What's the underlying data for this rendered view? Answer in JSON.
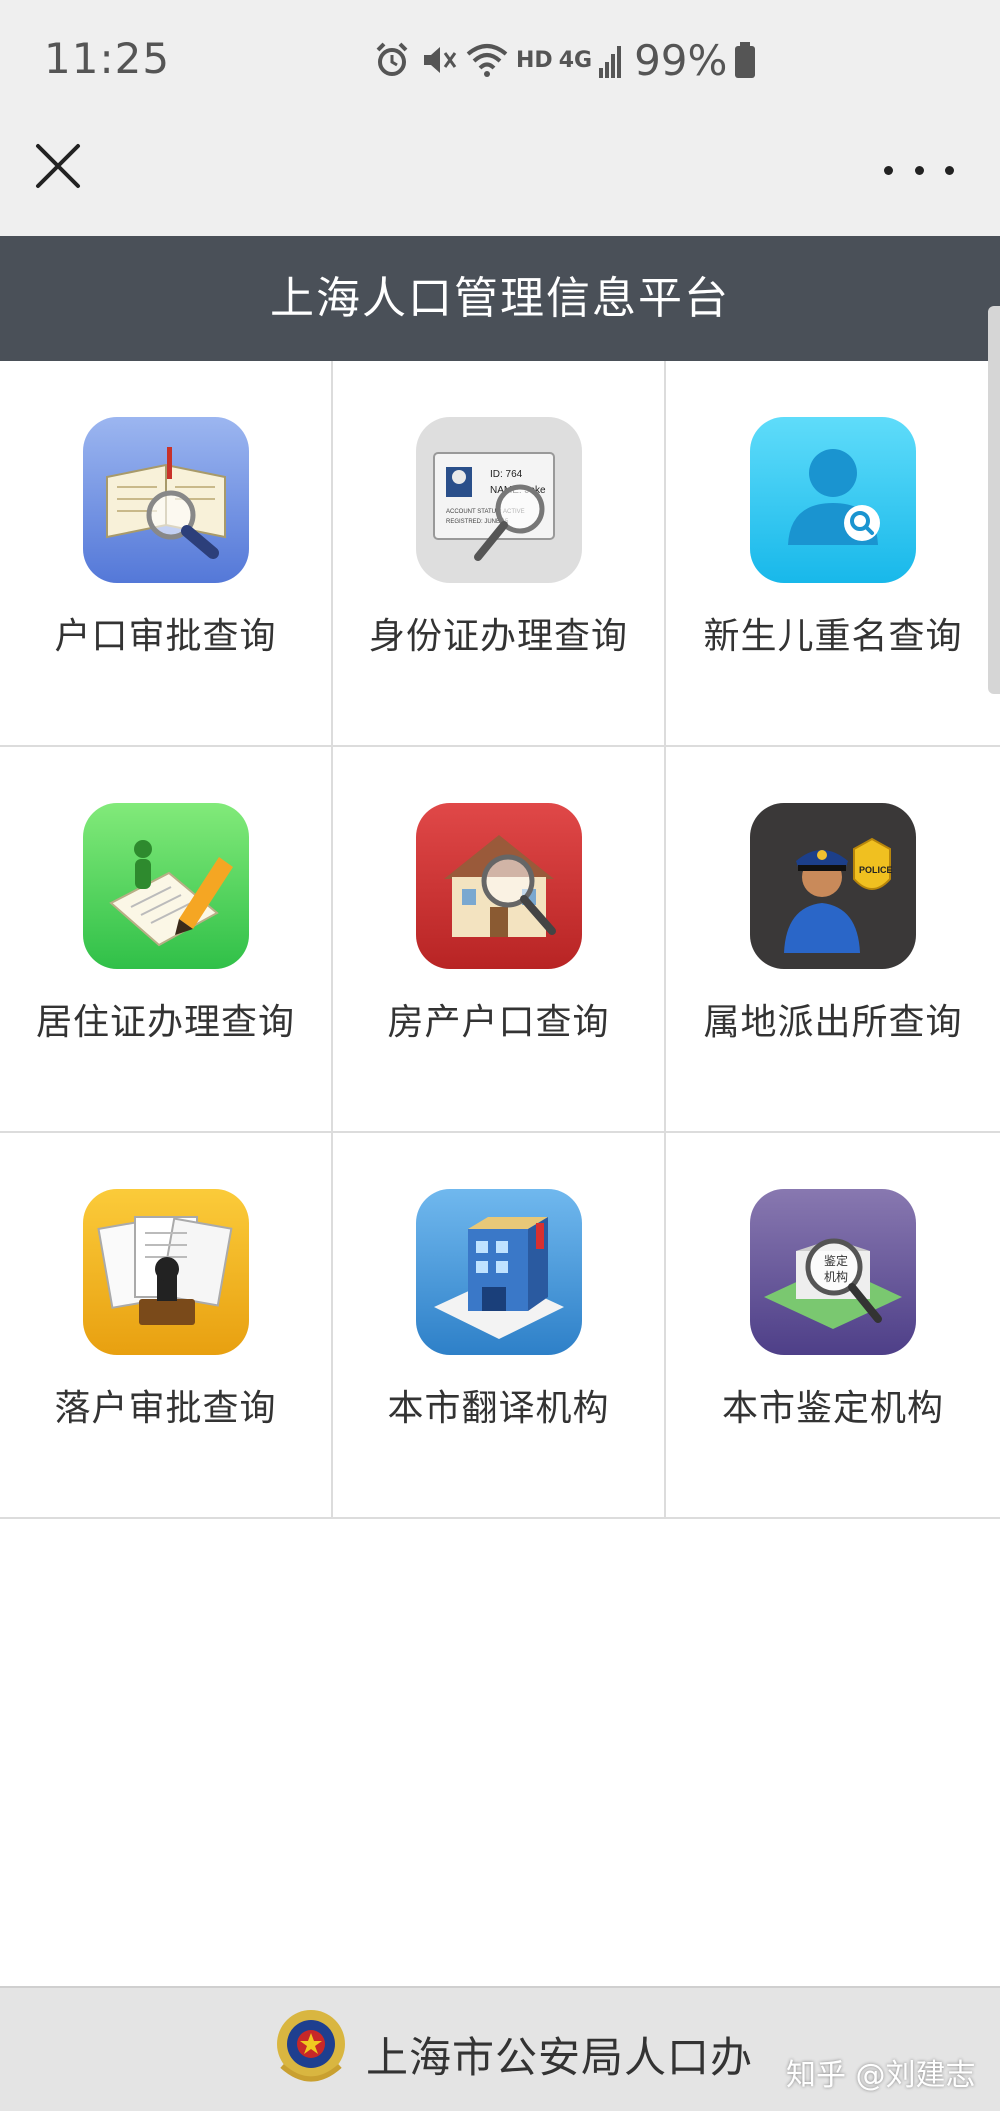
{
  "status_bar": {
    "time": "11:25",
    "network_type": "HD",
    "signal_label": "4G",
    "battery": "99%"
  },
  "nav_bar": {
    "close_icon": "close-icon",
    "more_icon": "more-icon"
  },
  "header": {
    "title": "上海人口管理信息平台"
  },
  "grid": {
    "items": [
      {
        "label": "户口审批查询",
        "icon": "book-search-icon",
        "color": "#6f92e6"
      },
      {
        "label": "身份证办理查询",
        "icon": "id-card-search-icon",
        "color": "#d9d9d9",
        "card_text": [
          "ID: 764",
          "NAME: Jake",
          "ACCOUNT STATUS: ACTIVE",
          "REGISTRED: JUNE 15"
        ]
      },
      {
        "label": "新生儿重名查询",
        "icon": "user-search-icon",
        "color": "#22c6f0"
      },
      {
        "label": "居住证办理查询",
        "icon": "document-edit-icon",
        "color": "#4ed45e"
      },
      {
        "label": "房产户口查询",
        "icon": "house-search-icon",
        "color": "#cc3030"
      },
      {
        "label": "属地派出所查询",
        "icon": "police-icon",
        "color": "#3b3a3a",
        "badge_text": "POLICE"
      },
      {
        "label": "落户审批查询",
        "icon": "stamp-documents-icon",
        "color": "#f0b020"
      },
      {
        "label": "本市翻译机构",
        "icon": "building-icon",
        "color": "#4a98d8"
      },
      {
        "label": "本市鉴定机构",
        "icon": "institution-search-icon",
        "color": "#6a5a9c",
        "sign_text": [
          "鉴定",
          "机构"
        ]
      }
    ]
  },
  "footer": {
    "label": "上海市公安局人口办",
    "emblem_icon": "police-emblem-icon"
  },
  "watermark": "知乎 @刘建志"
}
